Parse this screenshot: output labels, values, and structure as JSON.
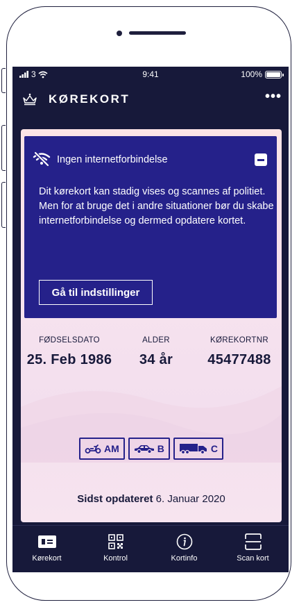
{
  "status_bar": {
    "carrier": "3",
    "time": "9:41",
    "battery": "100%"
  },
  "app_bar": {
    "title": "KØREKORT",
    "more": "•••"
  },
  "notice": {
    "heading": "Ingen internetforbindelse",
    "body": "Dit kørekort kan stadig vises og scannes af politiet. Men for at bruge det i andre situationer bør du skabe internetforbindelse og dermed opdatere kortet.",
    "button": "Gå til indstillinger"
  },
  "info": {
    "birth_label": "FØDSELSDATO",
    "birth_value": "25. Feb 1986",
    "age_label": "ALDER",
    "age_value": "34 år",
    "license_label": "KØREKORTNR",
    "license_value": "45477488"
  },
  "categories": [
    {
      "icon": "moped-icon",
      "label": "AM"
    },
    {
      "icon": "car-icon",
      "label": "B"
    },
    {
      "icon": "truck-icon",
      "label": "C"
    }
  ],
  "updated": {
    "label": "Sidst opdateret",
    "date": "6. Januar 2020"
  },
  "tabs": [
    {
      "label": "Kørekort",
      "icon": "license-icon",
      "active": true
    },
    {
      "label": "Kontrol",
      "icon": "qr-code-icon"
    },
    {
      "label": "Kortinfo",
      "icon": "info-icon"
    },
    {
      "label": "Scan kort",
      "icon": "scan-icon"
    }
  ],
  "colors": {
    "dark_navy": "#17193a",
    "notice_blue": "#25218a",
    "card_pink": "#f6e2ee"
  }
}
